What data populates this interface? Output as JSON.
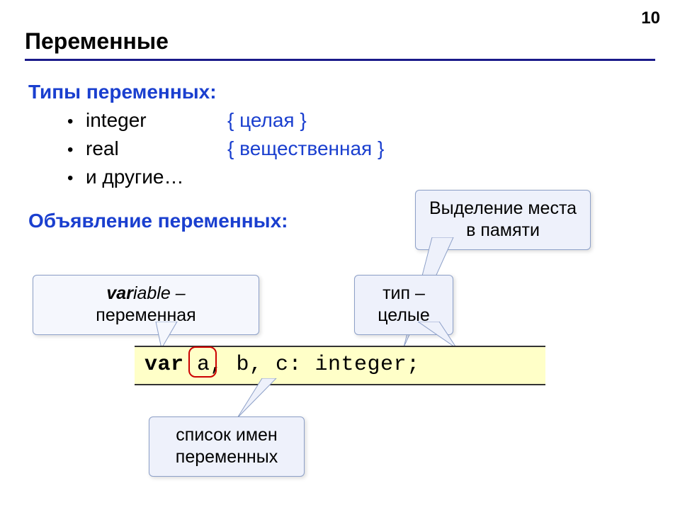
{
  "page_number": "10",
  "title": "Переменные",
  "section1": {
    "heading": "Типы переменных:",
    "rows": [
      {
        "name": "integer",
        "comment": "{ целая }"
      },
      {
        "name": "real",
        "comment": "{ вещественная }"
      },
      {
        "name": "и другие…",
        "comment": ""
      }
    ]
  },
  "section2": {
    "heading": "Объявление переменных:"
  },
  "callouts": {
    "memory": "Выделение места в памяти",
    "variable_line1_bold": "var",
    "variable_line1_rest": "iable –",
    "variable_line2": "переменная",
    "type_line1": "тип –",
    "type_line2": "целые",
    "list_line1": "список имен",
    "list_line2": "переменных"
  },
  "code": {
    "kw": "var",
    "rest": "  a, b, c: integer;"
  }
}
